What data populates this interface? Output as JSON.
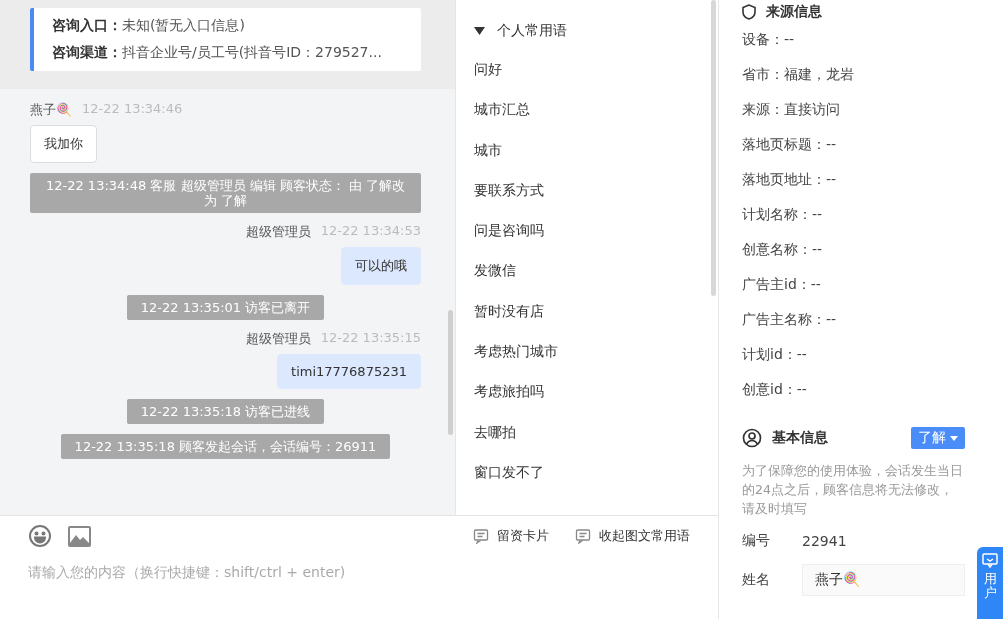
{
  "entry_card": {
    "fields": [
      {
        "label": "咨询入口：",
        "value": "未知(暂无入口信息)"
      },
      {
        "label": "咨询渠道：",
        "value": "抖音企业号/员工号(抖音号ID：279527..."
      }
    ]
  },
  "messages": [
    {
      "kind": "visitor",
      "sender": "燕子🍭",
      "time": "12-22 13:34:46",
      "text": "我加你"
    },
    {
      "kind": "system",
      "text": "12-22 13:34:48 客服 超级管理员 编辑 顾客状态： 由 了解改为 了解"
    },
    {
      "kind": "agent",
      "sender": "超级管理员",
      "time": "12-22 13:34:53",
      "text": "可以的哦"
    },
    {
      "kind": "system",
      "text": "12-22 13:35:01 访客已离开"
    },
    {
      "kind": "agent",
      "sender": "超级管理员",
      "time": "12-22 13:35:15",
      "text": "timi17776875231"
    },
    {
      "kind": "system",
      "text": "12-22 13:35:18 访客已进线"
    },
    {
      "kind": "system",
      "text": "12-22 13:35:18 顾客发起会话，会话编号：26911"
    }
  ],
  "composer": {
    "placeholder": "请输入您的内容（换行快捷键：shift/ctrl + enter)",
    "actions": [
      "留资卡片",
      "收起图文常用语"
    ]
  },
  "phrases": {
    "group": "个人常用语",
    "expanded": true,
    "items": [
      "问好",
      "城市汇总",
      "城市",
      "要联系方式",
      "问是咨询吗",
      "发微信",
      "暂时没有店",
      "考虑热门城市",
      "考虑旅拍吗",
      "去哪拍",
      "窗口发不了"
    ]
  },
  "source_info": {
    "title": "来源信息",
    "fields": [
      "设备：--",
      "省市：福建，龙岩",
      "来源：直接访问",
      "落地页标题：--",
      "落地页地址：--",
      "计划名称：--",
      "创意名称：--",
      "广告主id：--",
      "广告主名称：--",
      "计划id：--",
      "创意id：--"
    ]
  },
  "basic_info": {
    "title": "基本信息",
    "status": "了解",
    "notice": "为了保障您的使用体验，会话发生当日的24点之后，顾客信息将无法修改，请及时填写",
    "fields": [
      {
        "label": "编号",
        "value": "22941",
        "kind": "text"
      },
      {
        "label": "姓名",
        "value": "燕子🍭",
        "kind": "input"
      }
    ]
  },
  "side_tab": {
    "label": "用户"
  }
}
